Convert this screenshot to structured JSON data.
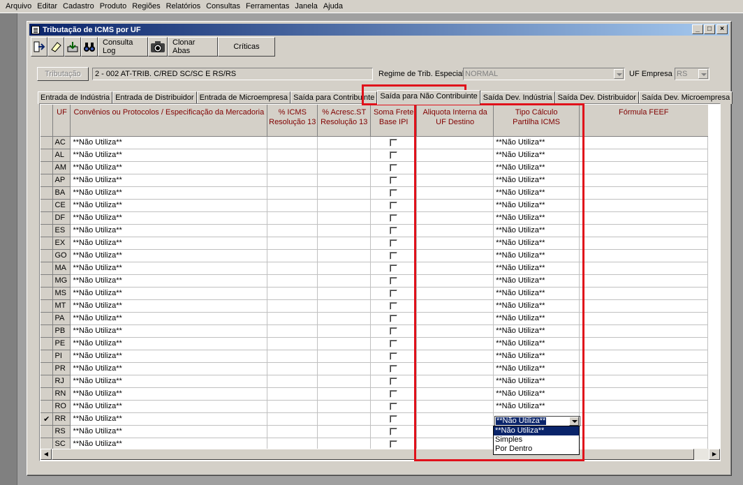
{
  "menu": [
    "Arquivo",
    "Editar",
    "Cadastro",
    "Produto",
    "Regiões",
    "Relatórios",
    "Consultas",
    "Ferramentas",
    "Janela",
    "Ajuda"
  ],
  "window": {
    "title": "Tributação de ICMS por UF",
    "minimize": "_",
    "maximize": "□",
    "close": "×"
  },
  "toolbar": {
    "consulta_log": "Consulta Log",
    "clonar_abas": "Clonar Abas",
    "criticas": "Críticas"
  },
  "form": {
    "tributacao_button": "Tributação",
    "tributacao_value": "2 - 002 AT-TRIB. C/RED SC/SC E RS/RS",
    "regime_label": "Regime de Trib. Especial",
    "regime_value": "NORMAL",
    "uf_empresa_label": "UF Empresa",
    "uf_empresa_value": "RS"
  },
  "tabs": [
    "Entrada de Indústria",
    "Entrada de Distribuidor",
    "Entrada de Microempresa",
    "Saída para Contribuinte",
    "Saída para Não Contribuinte",
    "Saída Dev. Indústria",
    "Saída Dev. Distribuidor",
    "Saída Dev. Microempresa"
  ],
  "active_tab": "Saída para Não Contribuinte",
  "grid": {
    "headers": {
      "uf": "UF",
      "convenios": "Convênios ou Protocolos / Especificação da Mercadoria",
      "icms_1": "% ICMS",
      "icms_2": "Resolução 13",
      "acresc_1": "% Acresc.ST",
      "acresc_2": "Resolução 13",
      "soma_1": "Soma Frete",
      "soma_2": "Base IPI",
      "aliq_1": "Aliquota Interna da",
      "aliq_2": "UF Destino",
      "tipo_1": "Tipo Cálculo",
      "tipo_2": "Partilha ICMS",
      "feef": "Fórmula FEEF"
    },
    "rows": [
      {
        "uf": "AC",
        "convenio": "**Não Utiliza**",
        "tipo": "**Não Utiliza**"
      },
      {
        "uf": "AL",
        "convenio": "**Não Utiliza**",
        "tipo": "**Não Utiliza**"
      },
      {
        "uf": "AM",
        "convenio": "**Não Utiliza**",
        "tipo": "**Não Utiliza**"
      },
      {
        "uf": "AP",
        "convenio": "**Não Utiliza**",
        "tipo": "**Não Utiliza**"
      },
      {
        "uf": "BA",
        "convenio": "**Não Utiliza**",
        "tipo": "**Não Utiliza**"
      },
      {
        "uf": "CE",
        "convenio": "**Não Utiliza**",
        "tipo": "**Não Utiliza**"
      },
      {
        "uf": "DF",
        "convenio": "**Não Utiliza**",
        "tipo": "**Não Utiliza**"
      },
      {
        "uf": "ES",
        "convenio": "**Não Utiliza**",
        "tipo": "**Não Utiliza**"
      },
      {
        "uf": "EX",
        "convenio": "**Não Utiliza**",
        "tipo": "**Não Utiliza**"
      },
      {
        "uf": "GO",
        "convenio": "**Não Utiliza**",
        "tipo": "**Não Utiliza**"
      },
      {
        "uf": "MA",
        "convenio": "**Não Utiliza**",
        "tipo": "**Não Utiliza**"
      },
      {
        "uf": "MG",
        "convenio": "**Não Utiliza**",
        "tipo": "**Não Utiliza**"
      },
      {
        "uf": "MS",
        "convenio": "**Não Utiliza**",
        "tipo": "**Não Utiliza**"
      },
      {
        "uf": "MT",
        "convenio": "**Não Utiliza**",
        "tipo": "**Não Utiliza**"
      },
      {
        "uf": "PA",
        "convenio": "**Não Utiliza**",
        "tipo": "**Não Utiliza**"
      },
      {
        "uf": "PB",
        "convenio": "**Não Utiliza**",
        "tipo": "**Não Utiliza**"
      },
      {
        "uf": "PE",
        "convenio": "**Não Utiliza**",
        "tipo": "**Não Utiliza**"
      },
      {
        "uf": "PI",
        "convenio": "**Não Utiliza**",
        "tipo": "**Não Utiliza**"
      },
      {
        "uf": "PR",
        "convenio": "**Não Utiliza**",
        "tipo": "**Não Utiliza**"
      },
      {
        "uf": "RJ",
        "convenio": "**Não Utiliza**",
        "tipo": "**Não Utiliza**"
      },
      {
        "uf": "RN",
        "convenio": "**Não Utiliza**",
        "tipo": "**Não Utiliza**"
      },
      {
        "uf": "RO",
        "convenio": "**Não Utiliza**",
        "tipo": "**Não Utiliza**"
      },
      {
        "uf": "RR",
        "convenio": "**Não Utiliza**",
        "tipo": "",
        "current": true
      },
      {
        "uf": "RS",
        "convenio": "**Não Utiliza**",
        "tipo": ""
      },
      {
        "uf": "SC",
        "convenio": "**Não Utiliza**",
        "tipo": ""
      }
    ]
  },
  "dropdown": {
    "current_value": "**Não Utiliza**",
    "options": [
      "**Não Utiliza**",
      "Simples",
      "Por Dentro"
    ]
  },
  "indicator_glyph": "✔",
  "colors": {
    "header_text": "#800000",
    "highlight_frame": "#e0101a",
    "selection": "#0a246a"
  }
}
